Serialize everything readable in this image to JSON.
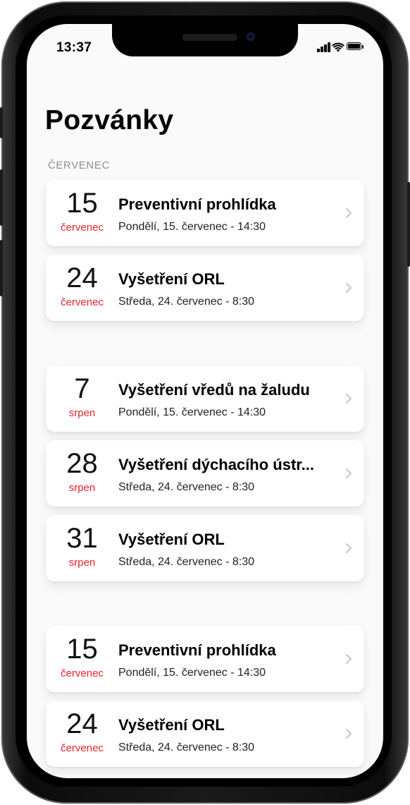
{
  "status_bar": {
    "time": "13:37"
  },
  "header": {
    "title": "Pozvánky"
  },
  "section": {
    "label": "ČERVENEC"
  },
  "colors": {
    "accent": "#e5252c",
    "secondary": "#8e8e93",
    "chevron": "#c7c7cc"
  },
  "icons": {
    "signal": "cellular-signal-icon",
    "wifi": "wifi-icon",
    "battery": "battery-icon",
    "chevron": "chevron-right-icon"
  },
  "invitations": [
    {
      "day": "15",
      "month": "červenec",
      "title": "Preventivní prohlídka",
      "subtitle": "Pondělí, 15. červenec - 14:30"
    },
    {
      "day": "24",
      "month": "červenec",
      "title": "Vyšetření ORL",
      "subtitle": "Středa, 24. červenec - 8:30"
    },
    {
      "day": "7",
      "month": "srpen",
      "title": "Vyšetření vředů na žaludu",
      "subtitle": "Pondělí, 15. červenec - 14:30"
    },
    {
      "day": "28",
      "month": "srpen",
      "title": "Vyšetření dýchacího ústr...",
      "subtitle": "Středa, 24. červenec - 8:30"
    },
    {
      "day": "31",
      "month": "srpen",
      "title": "Vyšetření ORL",
      "subtitle": "Středa, 24. červenec - 8:30"
    },
    {
      "day": "15",
      "month": "červenec",
      "title": "Preventivní prohlídka",
      "subtitle": "Pondělí, 15. červenec - 14:30"
    },
    {
      "day": "24",
      "month": "červenec",
      "title": "Vyšetření ORL",
      "subtitle": "Středa, 24. červenec - 8:30"
    }
  ]
}
